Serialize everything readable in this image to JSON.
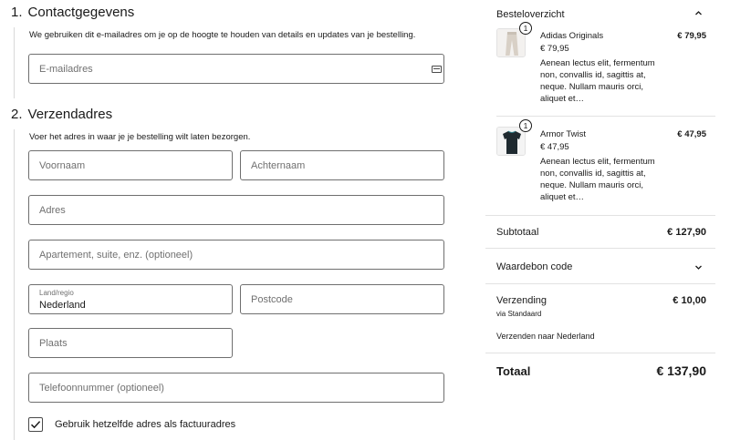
{
  "contact": {
    "number": "1.",
    "title": "Contactgegevens",
    "help": "We gebruiken dit e-mailadres om je op de hoogte te houden van details en updates van je bestelling.",
    "email_placeholder": "E-mailadres"
  },
  "shipping": {
    "number": "2.",
    "title": "Verzendadres",
    "help": "Voer het adres in waar je je bestelling wilt laten bezorgen.",
    "first_name_placeholder": "Voornaam",
    "last_name_placeholder": "Achternaam",
    "address_placeholder": "Adres",
    "apartment_placeholder": "Apartement, suite, enz. (optioneel)",
    "country_label": "Land/regio",
    "country_value": "Nederland",
    "postcode_placeholder": "Postcode",
    "city_placeholder": "Plaats",
    "phone_placeholder": "Telefoonnummer (optioneel)",
    "same_billing_label": "Gebruik hetzelfde adres als factuuradres",
    "same_billing_checked": true
  },
  "order": {
    "title": "Besteloverzicht",
    "items": [
      {
        "name": "Adidas Originals",
        "unit_price": "€ 79,95",
        "description": "Aenean lectus elit, fermentum non, convallis id, sagittis at, neque. Nullam mauris orci, aliquet et…",
        "total": "€ 79,95",
        "quantity": "1",
        "icon": "pants-thumbnail"
      },
      {
        "name": "Armor Twist",
        "unit_price": "€ 47,95",
        "description": "Aenean lectus elit, fermentum non, convallis id, sagittis at, neque. Nullam mauris orci, aliquet et…",
        "total": "€ 47,95",
        "quantity": "1",
        "icon": "tshirt-thumbnail"
      }
    ],
    "subtotal_label": "Subtotaal",
    "subtotal_value": "€ 127,90",
    "voucher_label": "Waardebon code",
    "shipping_label": "Verzending",
    "shipping_method": "via Standaard",
    "shipping_value": "€ 10,00",
    "ship_to": "Verzenden naar Nederland",
    "total_label": "Totaal",
    "total_value": "€ 137,90"
  }
}
